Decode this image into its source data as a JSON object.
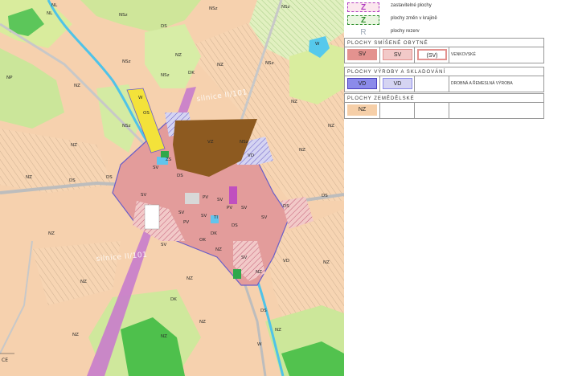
{
  "legend": {
    "top": [
      {
        "symbol": "Z",
        "text": "zastavitelné plochy",
        "color": "#b03cc0"
      },
      {
        "symbol": "Z",
        "text": "plochy změn v krajině",
        "color": "#2f8f2f"
      },
      {
        "symbol": "R",
        "text": "plochy rezerv",
        "color": "#9aa6b4"
      }
    ],
    "sections": [
      {
        "title": "PLOCHY SMÍŠENÉ OBYTNÉ",
        "codes": [
          "SV",
          "SV",
          "(SV)"
        ],
        "description": "VENKOVSKÉ",
        "color": "#e3928f"
      },
      {
        "title": "PLOCHY VÝROBY A SKLADOVÁNÍ",
        "codes": [
          "VD",
          "VD"
        ],
        "description": "DROBNÁ A ŘEMESLNÁ VÝROBA",
        "color": "#8b8bea"
      },
      {
        "title": "PLOCHY ZEMĚDĚLSKÉ",
        "codes": [
          "NZ"
        ],
        "description": "",
        "color": "#f6cfa8"
      }
    ]
  },
  "map": {
    "zone_labels": [
      "NSz",
      "NSz",
      "NSz",
      "NSz",
      "NSz",
      "NSz",
      "NSz",
      "NSz",
      "NZ",
      "NZ",
      "NZ",
      "NZ",
      "NZ",
      "NZ",
      "NZ",
      "NZ",
      "NZ",
      "NZ",
      "NZ",
      "NZ",
      "NZ",
      "NZ",
      "NZ",
      "NZ",
      "NZ",
      "NZ",
      "NL",
      "NL",
      "NP",
      "W",
      "W",
      "W",
      "DS",
      "DS",
      "DS",
      "DS",
      "DS",
      "DS",
      "DS",
      "DS",
      "DK",
      "DK",
      "DK",
      "SV",
      "SV",
      "SV",
      "SV",
      "SV",
      "SV",
      "SV",
      "SV",
      "SV",
      "VZ",
      "VD",
      "VD",
      "PV",
      "PV",
      "PV",
      "OS",
      "OK",
      "ZS",
      "TI"
    ],
    "road_labels": [
      "silnice II/101",
      "silnice II/101"
    ],
    "edge_label": "CE"
  }
}
